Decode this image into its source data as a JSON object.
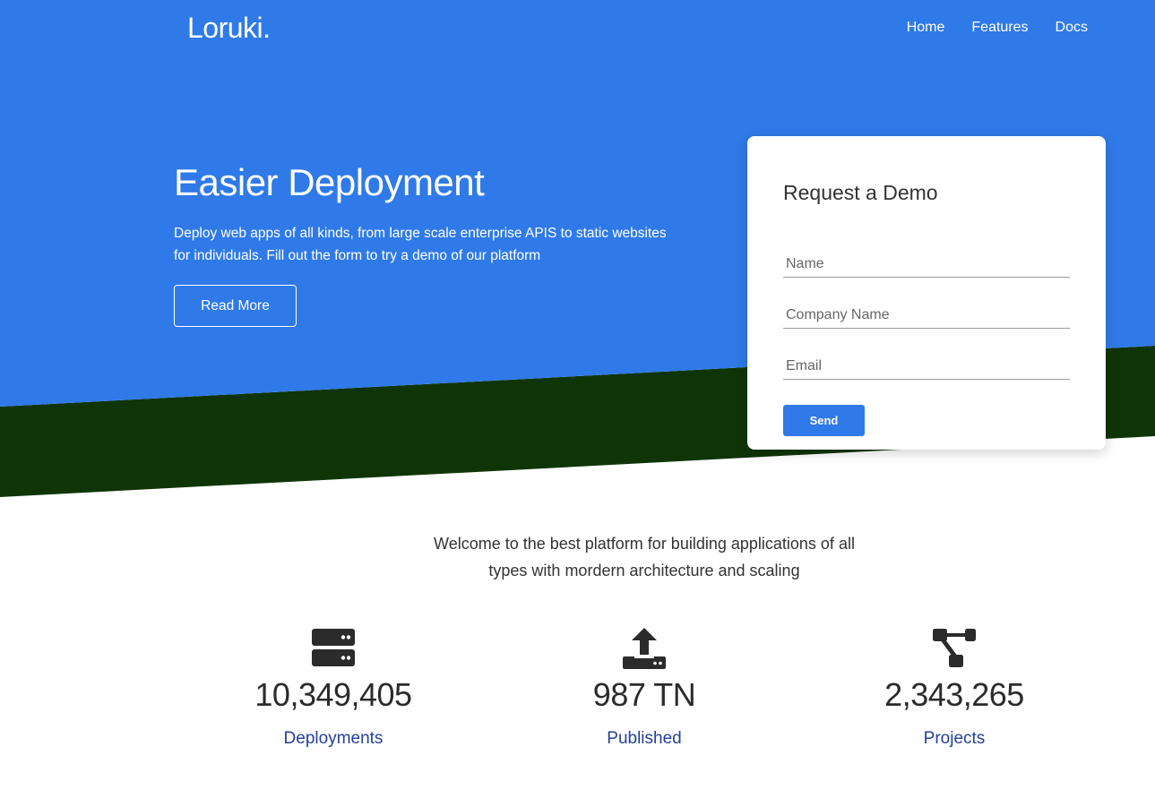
{
  "brand": {
    "name": "Loruki."
  },
  "nav": {
    "items": [
      "Home",
      "Features",
      "Docs"
    ]
  },
  "hero": {
    "title": "Easier Deployment",
    "description": "Deploy web apps of all kinds, from large scale enterprise APIS to static websites for individuals. Fill out the form to try a demo of our platform",
    "button_label": "Read More"
  },
  "demo_form": {
    "title": "Request a Demo",
    "fields": [
      {
        "placeholder": "Name",
        "value": ""
      },
      {
        "placeholder": "Company Name",
        "value": ""
      },
      {
        "placeholder": "Email",
        "value": ""
      }
    ],
    "submit_label": "Send"
  },
  "welcome": {
    "text": "Welcome to the best platform for building applications of all types with mordern architecture and scaling"
  },
  "stats": [
    {
      "icon": "server-icon",
      "value": "10,349,405",
      "label": "Deployments"
    },
    {
      "icon": "upload-icon",
      "value": "987 TN",
      "label": "Published"
    },
    {
      "icon": "project-diagram-icon",
      "value": "2,343,265",
      "label": "Projects"
    }
  ],
  "colors": {
    "primary": "#2f7ae8",
    "accent_dark": "#0f3507",
    "stat_label": "#24409a",
    "text_dark": "#333333"
  }
}
